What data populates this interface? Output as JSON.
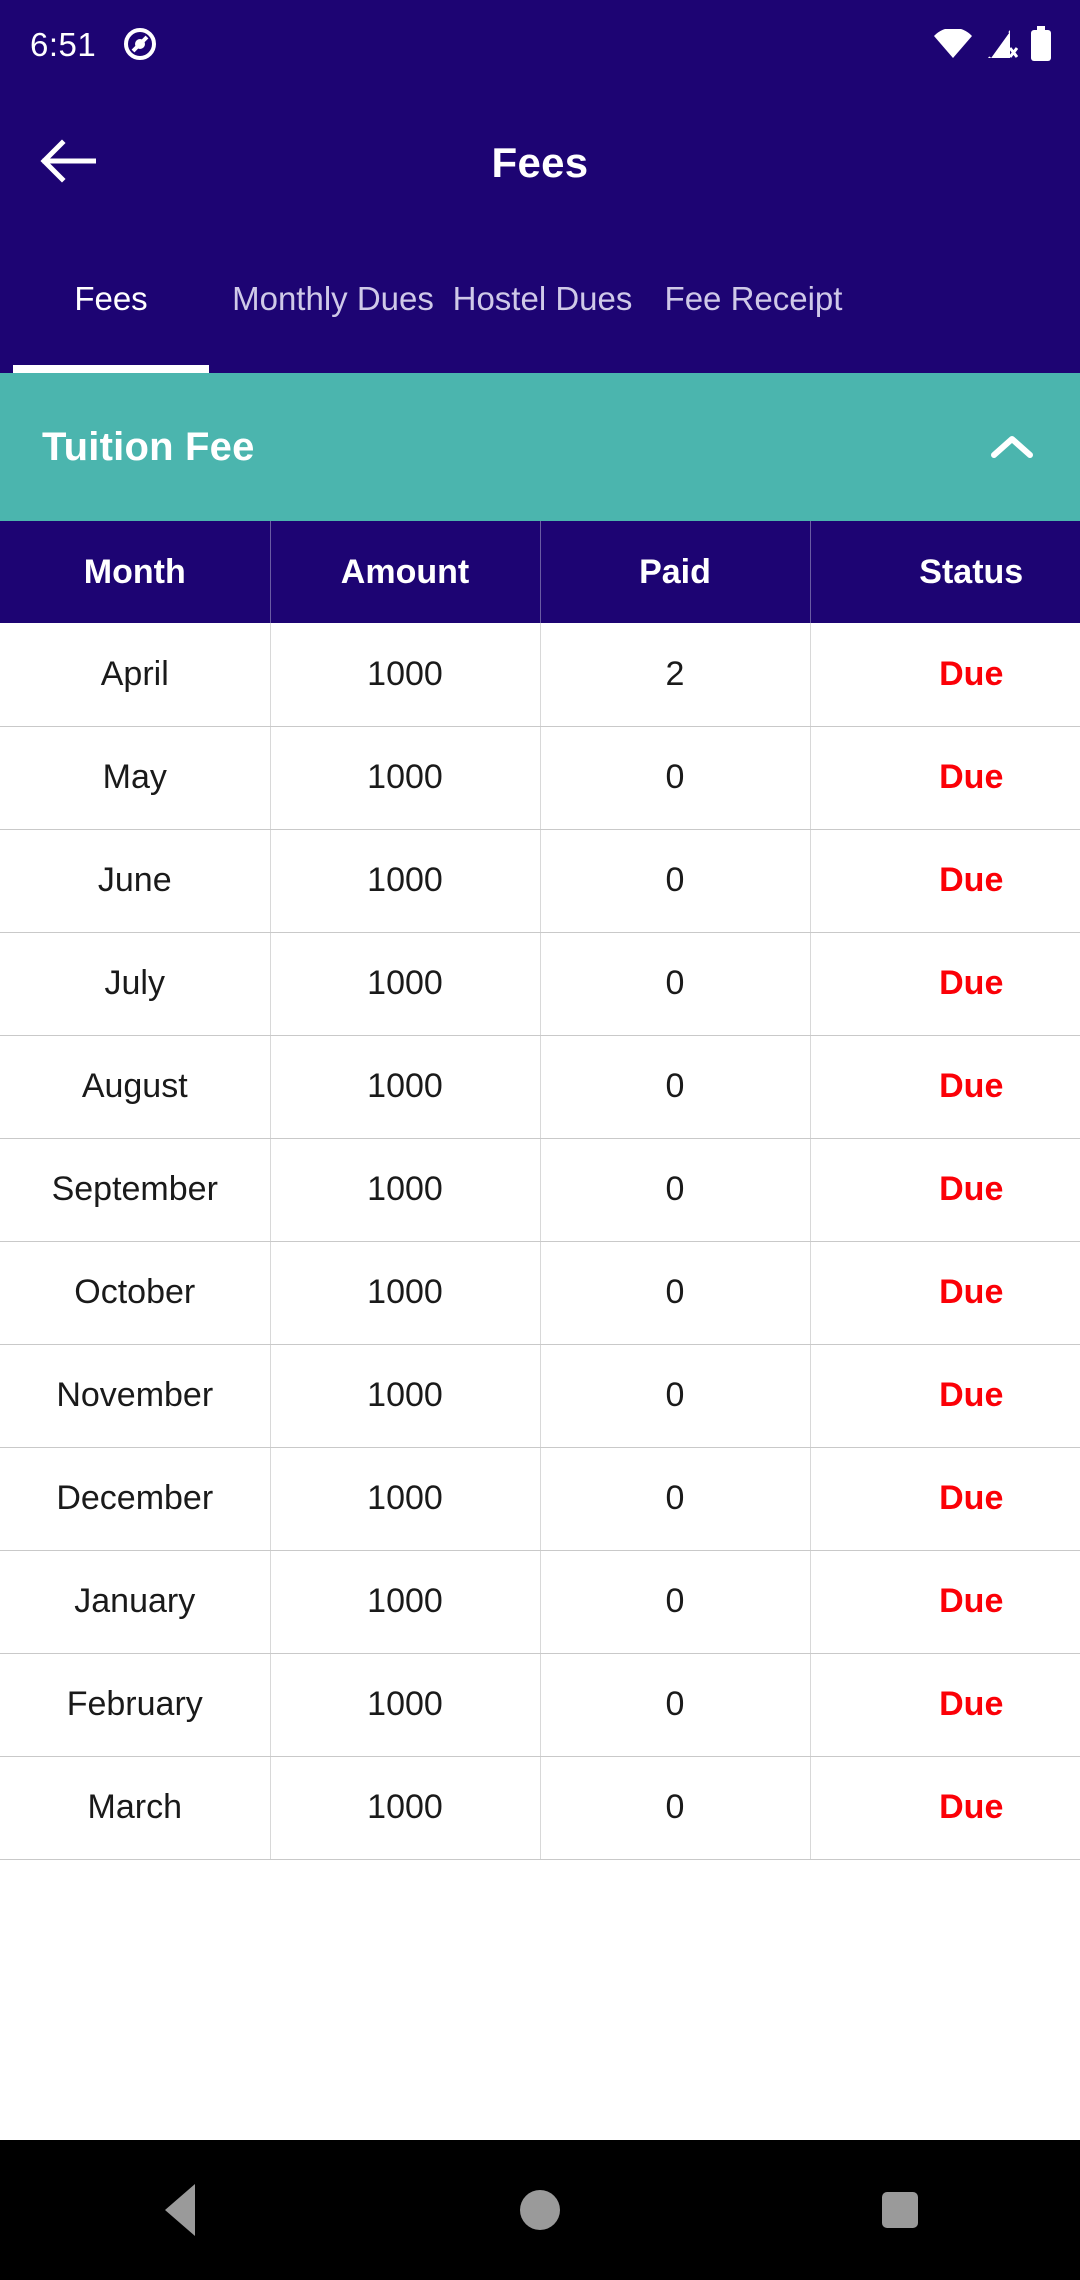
{
  "status_bar": {
    "time": "6:51",
    "icons": [
      "notification-circle-icon",
      "wifi-icon",
      "cellular-off-icon",
      "battery-icon"
    ]
  },
  "app_bar": {
    "back_icon": "back-arrow-icon",
    "title": "Fees"
  },
  "tabs": {
    "active_index": 0,
    "items": [
      {
        "label": "Fees"
      },
      {
        "label": "Monthly Dues"
      },
      {
        "label": "Hostel Dues"
      },
      {
        "label": "Fee Receipt"
      }
    ]
  },
  "section": {
    "title": "Tuition Fee",
    "expanded": true,
    "chevron_icon": "chevron-up-icon",
    "background_color": "#4bb5ae"
  },
  "table": {
    "headers": [
      "Month",
      "Amount",
      "Paid",
      "Status"
    ],
    "rows": [
      {
        "month": "April",
        "amount": "1000",
        "paid": "2",
        "status": "Due"
      },
      {
        "month": "May",
        "amount": "1000",
        "paid": "0",
        "status": "Due"
      },
      {
        "month": "June",
        "amount": "1000",
        "paid": "0",
        "status": "Due"
      },
      {
        "month": "July",
        "amount": "1000",
        "paid": "0",
        "status": "Due"
      },
      {
        "month": "August",
        "amount": "1000",
        "paid": "0",
        "status": "Due"
      },
      {
        "month": "September",
        "amount": "1000",
        "paid": "0",
        "status": "Due"
      },
      {
        "month": "October",
        "amount": "1000",
        "paid": "0",
        "status": "Due"
      },
      {
        "month": "November",
        "amount": "1000",
        "paid": "0",
        "status": "Due"
      },
      {
        "month": "December",
        "amount": "1000",
        "paid": "0",
        "status": "Due"
      },
      {
        "month": "January",
        "amount": "1000",
        "paid": "0",
        "status": "Due"
      },
      {
        "month": "February",
        "amount": "1000",
        "paid": "0",
        "status": "Due"
      },
      {
        "month": "March",
        "amount": "1000",
        "paid": "0",
        "status": "Due"
      }
    ],
    "status_color": "#fb0007",
    "header_background": "#1d0473"
  },
  "nav_bar": {
    "back_icon": "nav-back-triangle-icon",
    "home_icon": "nav-home-circle-icon",
    "recents_icon": "nav-recents-square-icon"
  },
  "theme": {
    "primary": "#1d0473",
    "accent": "#4bb5ae",
    "danger": "#fb0007"
  }
}
